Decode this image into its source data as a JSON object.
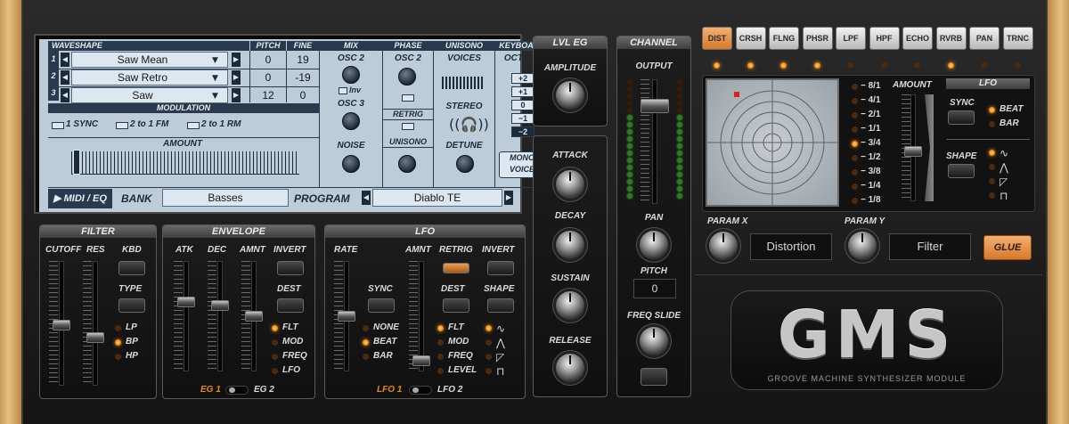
{
  "lcd": {
    "headers": {
      "waveshape": "WAVESHAPE",
      "pitch": "PITCH",
      "fine": "FINE",
      "mix": "MIX",
      "phase": "PHASE",
      "unisono": "UNISONO",
      "keyboard": "KEYBOARD",
      "modulation": "MODULATION",
      "amount": "AMOUNT"
    },
    "rows": [
      {
        "index": "1",
        "wave": "Saw Mean",
        "pitch": "0",
        "fine": "19"
      },
      {
        "index": "2",
        "wave": "Saw Retro",
        "pitch": "0",
        "fine": "-19"
      },
      {
        "index": "3",
        "wave": "Saw",
        "pitch": "12",
        "fine": "0"
      }
    ],
    "mix": {
      "osc2": "OSC 2",
      "inv": "Inv",
      "osc3": "OSC 3",
      "noise": "NOISE"
    },
    "phase": {
      "osc2": "OSC 2",
      "retrig": "RETRIG",
      "unisono": "UNISONO"
    },
    "unisono": {
      "voices": "VOICES",
      "stereo": "STEREO",
      "detune": "DETUNE"
    },
    "keyboard": {
      "octave": "OCTAVE",
      "octaves": [
        "+2",
        "+1",
        "0",
        "−1",
        "−2"
      ],
      "selected_index": 4,
      "mono_line1": "MONO",
      "mono_line2": "VOICE"
    },
    "mod": {
      "sync": "1 SYNC",
      "fm": "2 to 1 FM",
      "rm": "2 to 1 RM"
    },
    "footer": {
      "midi": "▶ MIDI / EQ",
      "bank_label": "BANK",
      "bank_value": "Basses",
      "program_label": "PROGRAM",
      "program_value": "Diablo TE"
    }
  },
  "filter": {
    "title": "FILTER",
    "cutoff": "CUTOFF",
    "res": "RES",
    "kbd": "KBD",
    "type": "TYPE",
    "types": [
      "LP",
      "BP",
      "HP"
    ],
    "active_type": "BP"
  },
  "envelope": {
    "title": "ENVELOPE",
    "atk": "ATK",
    "dec": "DEC",
    "amnt": "AMNT",
    "invert": "INVERT",
    "dest": "DEST",
    "dests": [
      "FLT",
      "MOD",
      "FREQ",
      "LFO"
    ],
    "active_dest": "FLT",
    "eg1": "EG 1",
    "eg2": "EG 2"
  },
  "lfo": {
    "title": "LFO",
    "rate": "RATE",
    "amnt": "AMNT",
    "retrig": "RETRIG",
    "invert": "INVERT",
    "sync": "SYNC",
    "dest": "DEST",
    "shape": "SHAPE",
    "syncs": [
      "NONE",
      "BEAT",
      "BAR"
    ],
    "active_sync": "BEAT",
    "dests": [
      "FLT",
      "MOD",
      "FREQ",
      "LEVEL"
    ],
    "active_dest": "FLT",
    "lfo1": "LFO 1",
    "lfo2": "LFO 2"
  },
  "lvl_eg": {
    "title": "LVL EG",
    "amplitude": "AMPLITUDE",
    "attack": "ATTACK",
    "decay": "DECAY",
    "sustain": "SUSTAIN",
    "release": "RELEASE"
  },
  "channel": {
    "title": "CHANNEL",
    "output": "OUTPUT",
    "pan": "PAN",
    "pitch": "PITCH",
    "pitch_value": "0",
    "freq_slide": "FREQ SLIDE"
  },
  "fx": {
    "buttons": [
      "DIST",
      "CRSH",
      "FLNG",
      "PHSR",
      "LPF",
      "HPF",
      "ECHO",
      "RVRB",
      "PAN",
      "TRNC"
    ],
    "active": "DIST",
    "lit_leds": [
      "DIST",
      "CRSH",
      "FLNG",
      "PHSR",
      "RVRB"
    ],
    "rates": [
      "8/1",
      "4/1",
      "2/1",
      "1/1",
      "3/4",
      "1/2",
      "3/8",
      "1/4",
      "1/8"
    ],
    "active_rate": "3/4",
    "amount": "AMOUNT",
    "lfo": "LFO",
    "sync": "SYNC",
    "beat": "BEAT",
    "bar": "BAR",
    "active_sync": "BEAT",
    "shape": "SHAPE",
    "param_x": "PARAM X",
    "param_x_value": "Distortion",
    "param_y": "PARAM Y",
    "param_y_value": "Filter",
    "glue": "GLUE"
  },
  "logo": {
    "text": "GMS",
    "subtitle": "GROOVE MACHINE SYNTHESIZER MODULE"
  },
  "colors": {
    "accent": "#f08a10",
    "lcd": "#bcccd8"
  }
}
